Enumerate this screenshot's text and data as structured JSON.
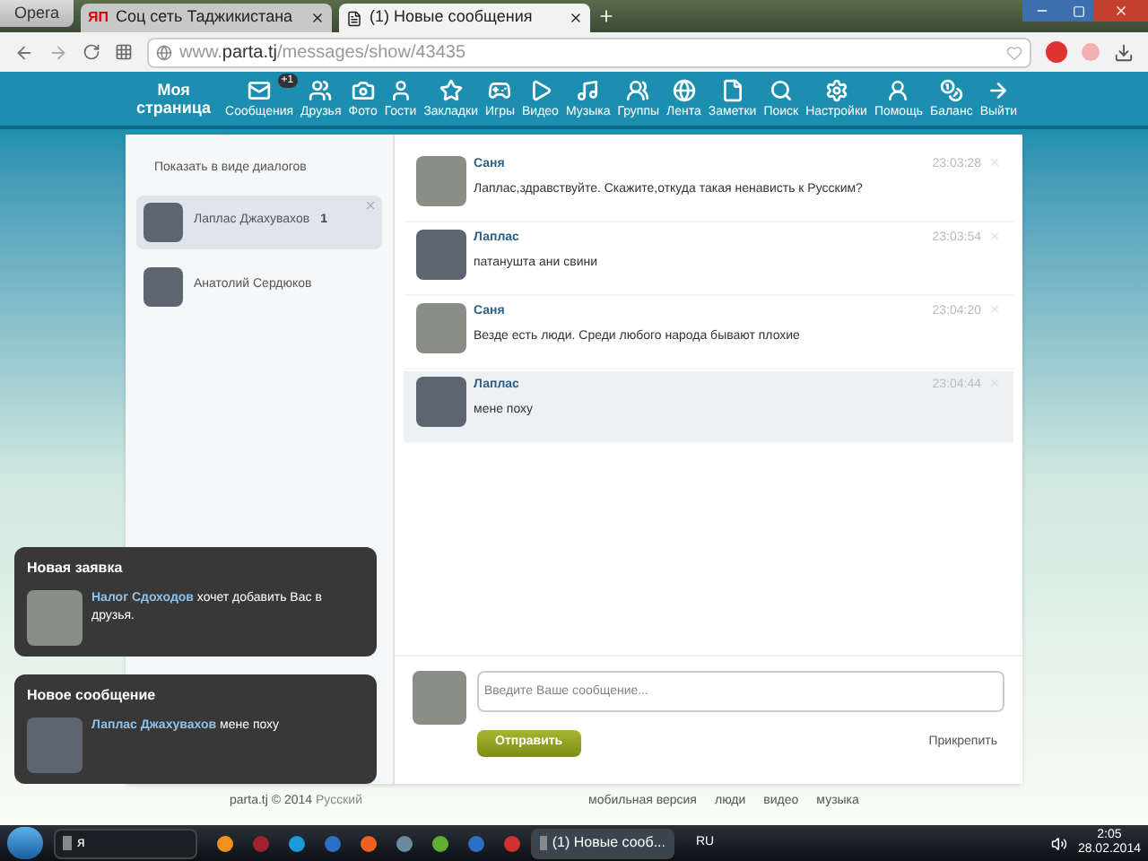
{
  "browser": {
    "menu_button": "Opera",
    "tabs": [
      {
        "logo": "ЯП",
        "title": "Соц сеть Таджикистана",
        "selected": false
      },
      {
        "title": "(1) Новые сообщения",
        "selected": true
      }
    ],
    "url": {
      "prefix": "www.",
      "host": "parta.tj",
      "path": "/messages/show/43435"
    }
  },
  "nav": {
    "home": [
      "Моя",
      "страница"
    ],
    "items": [
      {
        "label": "Сообщения",
        "badge": "+1"
      },
      {
        "label": "Друзья"
      },
      {
        "label": "Фото"
      },
      {
        "label": "Гости"
      },
      {
        "label": "Закладки"
      },
      {
        "label": "Игры"
      },
      {
        "label": "Видео"
      },
      {
        "label": "Музыка"
      },
      {
        "label": "Группы"
      },
      {
        "label": "Лента"
      },
      {
        "label": "Заметки"
      },
      {
        "label": "Поиск"
      },
      {
        "label": "Настройки"
      },
      {
        "label": "Помощь"
      },
      {
        "label": "Баланс"
      },
      {
        "label": "Выйти"
      }
    ]
  },
  "sidebar": {
    "toggle": "Показать в виде диалогов",
    "dialogs": [
      {
        "name": "Лаплас Джахувахов",
        "unread": "1",
        "selected": true
      },
      {
        "name": "Анатолий Сердюков",
        "selected": false
      }
    ]
  },
  "messages": [
    {
      "author": "Саня",
      "text": "Лаплас,здравствуйте. Скажите,откуда такая ненависть к Русским?",
      "time": "23:03:28",
      "highlighted": false
    },
    {
      "author": "Лаплас",
      "text": "патанушта ани свини",
      "time": "23:03:54",
      "highlighted": false
    },
    {
      "author": "Саня",
      "text": "Везде есть люди. Среди любого народа бывают плохие",
      "time": "23:04:20",
      "highlighted": false
    },
    {
      "author": "Лаплас",
      "text": "мене поху",
      "time": "23:04:44",
      "highlighted": true
    }
  ],
  "compose": {
    "placeholder": "Введите Ваше сообщение...",
    "send": "Отправить",
    "attach": "Прикрепить"
  },
  "notifications": [
    {
      "title": "Новая заявка",
      "user": "Налог Сдоходов",
      "text": "хочет добавить Вас в друзья."
    },
    {
      "title": "Новое сообщение",
      "user": "Лаплас Джахувахов",
      "text": "мене поху"
    }
  ],
  "footer": {
    "copyright": "parta.tj © 2014",
    "language": "Русский",
    "links": [
      "мобильная версия",
      "люди",
      "видео",
      "музыка"
    ]
  },
  "taskbar": {
    "items": [
      {
        "label": "я",
        "selected": false
      },
      {
        "label": "(1) Новые сооб...",
        "selected": true
      }
    ],
    "language": "RU",
    "time": "2:05",
    "date": "28.02.2014"
  }
}
